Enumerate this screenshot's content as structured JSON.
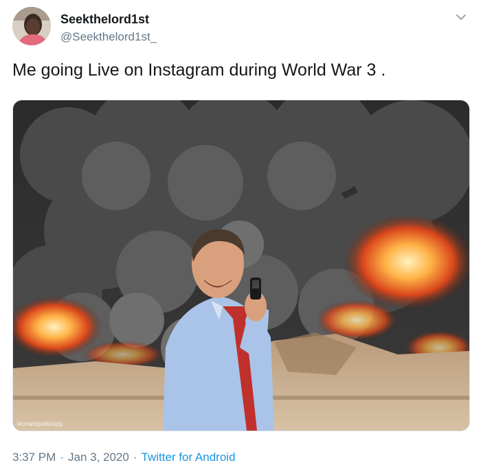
{
  "tweet": {
    "display_name": "Seekthelord1st",
    "handle": "@Seekthelord1st_",
    "text": "Me going Live on Instagram during World War 3 .",
    "photo_watermark": "leonardpollunipp",
    "time": "3:37 PM",
    "date": "Jan 3, 2020",
    "source": "Twitter for Android",
    "separator": "·"
  },
  "icons": {
    "menu": "chevron-down-icon",
    "avatar": "user-avatar"
  },
  "colors": {
    "text": "#14171a",
    "secondary": "#657786",
    "link": "#1b95e0"
  }
}
